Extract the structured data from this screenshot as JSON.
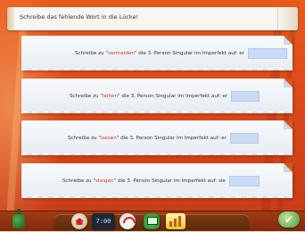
{
  "header": {
    "title": "Schreibe das fehlende Wort in die Lücke!"
  },
  "exercises": [
    {
      "prefix": "Schreibe zu \"",
      "verb": "vermeiden",
      "suffix": "\" die 3. Person Singular im Imperfekt auf: er",
      "answer": ""
    },
    {
      "prefix": "Schreibe zu \"",
      "verb": "leihen",
      "suffix": "\" die 3. Person Singular im Imperfekt auf: er",
      "answer": ""
    },
    {
      "prefix": "Schreibe zu \"",
      "verb": "lassen",
      "suffix": "\" die 3. Person Singular im Imperfekt auf: er",
      "answer": ""
    },
    {
      "prefix": "Schreibe zu \"",
      "verb": "steigen",
      "suffix": "\" die 3. Person Singular im Imperfekt auf: sie",
      "answer": ""
    }
  ],
  "toolbar": {
    "clock_text": "7:00",
    "icons": [
      "home-icon",
      "clock-icon",
      "gauge-icon",
      "monitor-icon",
      "chart-icon"
    ],
    "check_label": "✔"
  },
  "colors": {
    "verb": "#d23b1e",
    "background": "#d8461a",
    "answer_field": "#c9dcf3",
    "check": "#4f9b3a"
  }
}
